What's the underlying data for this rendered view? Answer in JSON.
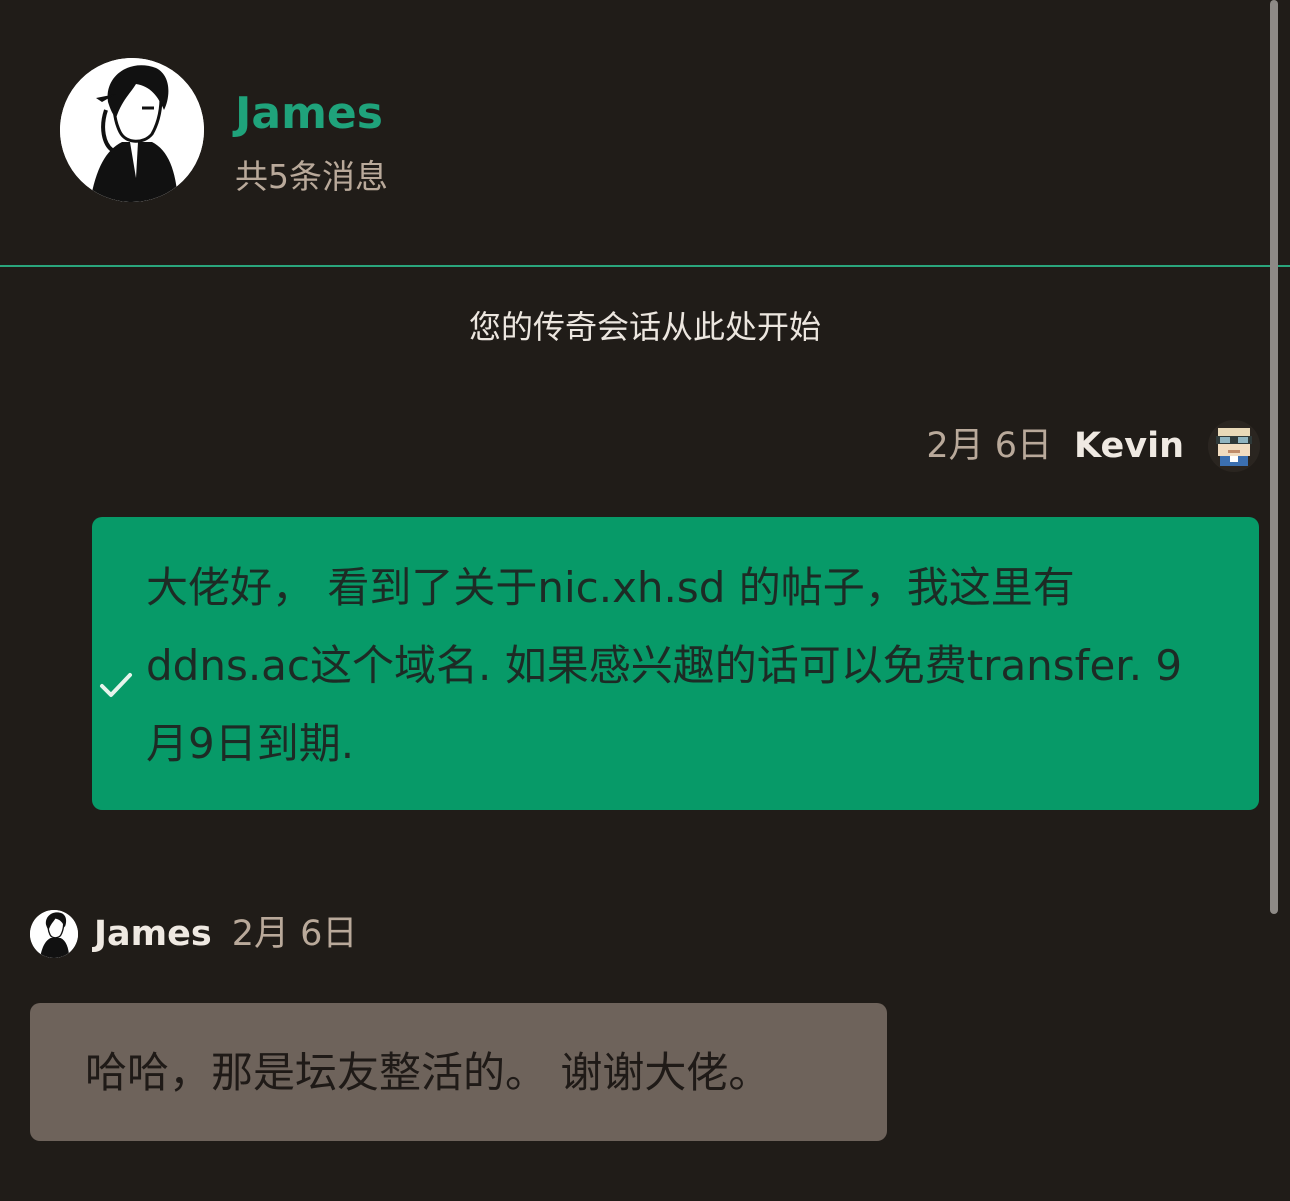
{
  "header": {
    "contact_name": "James",
    "message_count": "共5条消息"
  },
  "conversation_start": "您的传奇会话从此处开始",
  "messages": [
    {
      "direction": "outgoing",
      "sender": "Kevin",
      "date": "2月 6日",
      "status_icon": "check-icon",
      "text": "大佬好， 看到了关于nic.xh.sd 的帖子，我这里有ddns.ac这个域名. 如果感兴趣的话可以免费transfer. 9月9日到期."
    },
    {
      "direction": "incoming",
      "sender": "James",
      "date": "2月 6日",
      "text": "哈哈，那是坛友整活的。 谢谢大佬。"
    }
  ],
  "colors": {
    "background": "#201c18",
    "accent": "#1fa37b",
    "outgoing_bubble": "#079a68",
    "incoming_bubble": "#6e635b",
    "muted_text": "#b9a99a"
  }
}
